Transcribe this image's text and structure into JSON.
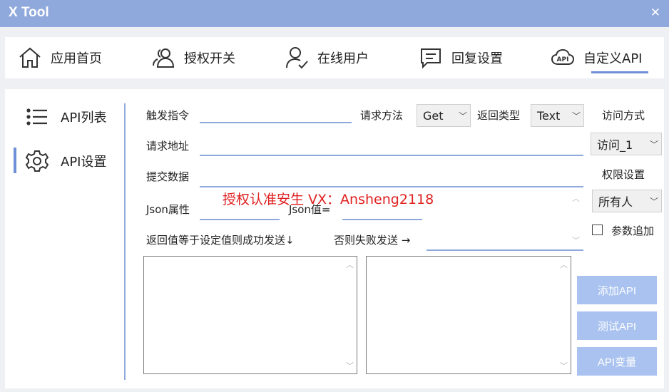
{
  "window": {
    "title": "X Tool",
    "close_glyph": "✕"
  },
  "nav": {
    "items": [
      {
        "label": "应用首页",
        "icon": "home-icon"
      },
      {
        "label": "授权开关",
        "icon": "users-icon"
      },
      {
        "label": "在线用户",
        "icon": "user-check-icon"
      },
      {
        "label": "回复设置",
        "icon": "message-icon"
      },
      {
        "label": "自定义API",
        "icon": "api-icon",
        "active": true
      }
    ],
    "accent": "#6f8fd8"
  },
  "sidebar": {
    "items": [
      {
        "label": "API列表",
        "icon": "list-icon"
      },
      {
        "label": "API设置",
        "icon": "gear-icon",
        "active": true
      }
    ]
  },
  "form": {
    "trigger_label": "触发指令",
    "trigger_value": "",
    "method_label": "请求方法",
    "method_value": "Get",
    "return_type_label": "返回类型",
    "return_type_value": "Text",
    "access_mode_label": "访问方式",
    "access_mode_value": "访问_1",
    "url_label": "请求地址",
    "url_value": "",
    "submit_label": "提交数据",
    "submit_value": "",
    "permission_label": "权限设置",
    "permission_value": "所有人",
    "json_attr_label": "Json属性",
    "json_value_label": "Json值=",
    "param_append_label": "参数追加",
    "param_append_checked": false,
    "success_hint": "返回值等于设定值则成功发送↓",
    "fail_hint": "否则失败发送 →",
    "fail_value": ""
  },
  "watermark": "授权认准安生  VX：Ansheng2118",
  "buttons": {
    "add": "添加API",
    "test": "测试API",
    "vars": "API变量"
  },
  "colors": {
    "titlebar": "#8fa9dc",
    "button": "#a9c2ef",
    "watermark": "#e02020"
  }
}
